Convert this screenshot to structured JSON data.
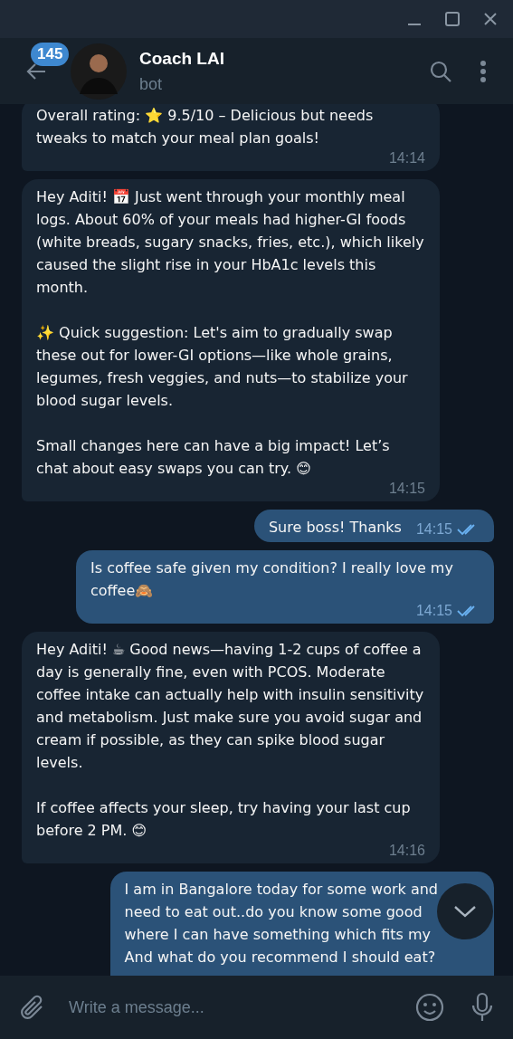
{
  "header": {
    "unread_count": "145",
    "name": "Coach LAI",
    "status": "bot"
  },
  "messages": [
    {
      "kind": "incoming",
      "text": "Overall rating: ⭐ 9.5/10 – Delicious but needs tweaks to match your meal plan goals!",
      "time": "14:14"
    },
    {
      "kind": "incoming",
      "text": "Hey Aditi! 📅 Just went through your monthly meal logs. About 60% of your meals had higher-GI foods (white breads, sugary snacks, fries, etc.), which likely caused the slight rise in your HbA1c levels this month.\n\n✨ Quick suggestion: Let's aim to gradually swap these out for lower-GI options—like whole grains, legumes, fresh veggies, and nuts—to stabilize your blood sugar levels.\n\nSmall changes here can have a big impact! Let’s chat about easy swaps you can try. 😊",
      "time": "14:15"
    },
    {
      "kind": "outgoing",
      "text": "Sure boss! Thanks",
      "time": "14:15",
      "read": true
    },
    {
      "kind": "outgoing",
      "text": "Is coffee safe given my condition? I really love my coffee🙈",
      "time": "14:15",
      "read": true
    },
    {
      "kind": "incoming",
      "text": "Hey Aditi! ☕ Good news—having 1-2 cups of coffee a day is generally fine, even with PCOS. Moderate coffee intake can actually help with insulin sensitivity and metabolism. Just make sure you avoid sugar and cream if possible, as they can spike blood sugar levels.\n\nIf coffee affects your sleep, try having your last cup before 2 PM. 😊",
      "time": "14:16"
    },
    {
      "kind": "outgoing",
      "text": "I am in Bangalore today for some work and\nneed to eat out..do you know some good\nwhere I can have something which fits my\nAnd what do you recommend I should eat?"
    }
  ],
  "composer": {
    "placeholder": "Write a message..."
  }
}
